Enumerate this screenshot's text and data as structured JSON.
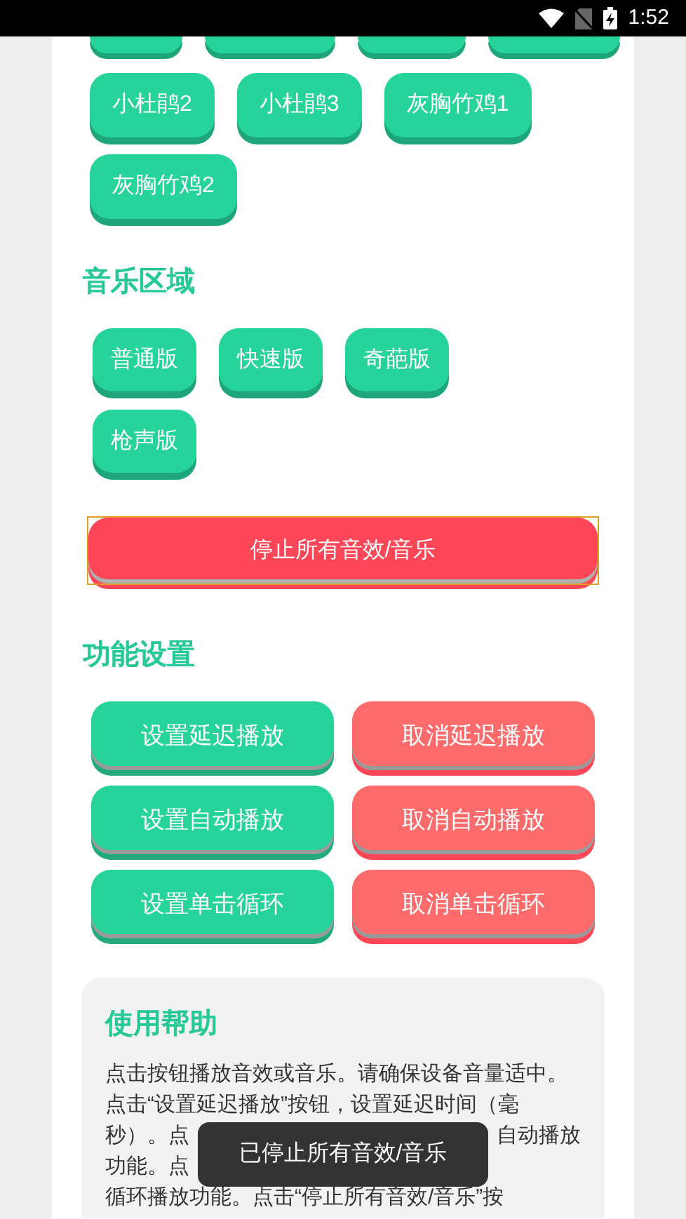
{
  "status_bar": {
    "time": "1:52"
  },
  "clipped_buttons": [
    {
      "kind": "button"
    },
    {
      "kind": "button"
    },
    {
      "kind": "button"
    },
    {
      "kind": "button"
    }
  ],
  "bird_buttons": [
    "小杜鹃2",
    "小杜鹃3",
    "灰胸竹鸡1",
    "灰胸竹鸡2"
  ],
  "music_section": {
    "title": "音乐区域",
    "buttons": [
      "普通版",
      "快速版",
      "奇葩版",
      "枪声版"
    ]
  },
  "stop_button": {
    "label": "停止所有音效/音乐",
    "focused": true
  },
  "settings_section": {
    "title": "功能设置",
    "buttons": [
      {
        "label": "设置延迟播放",
        "kind": "set"
      },
      {
        "label": "取消延迟播放",
        "kind": "cancel"
      },
      {
        "label": "设置自动播放",
        "kind": "set"
      },
      {
        "label": "取消自动播放",
        "kind": "cancel"
      },
      {
        "label": "设置单击循环",
        "kind": "set"
      },
      {
        "label": "取消单击循环",
        "kind": "cancel"
      }
    ]
  },
  "help": {
    "title": "使用帮助",
    "lines": [
      {
        "left": "点击按钮播放音效或音乐。请确保设备音量适中。"
      },
      {
        "left": "点击“设置延迟播放”按钮，设置延迟时间（毫"
      },
      {
        "left": "秒）。点",
        "right": "自动播放"
      },
      {
        "left": "功能。点"
      },
      {
        "left": "循环播放功能。点击“停止所有音效/音乐”按"
      }
    ]
  },
  "toast": {
    "text": "已停止所有音效/音乐"
  }
}
